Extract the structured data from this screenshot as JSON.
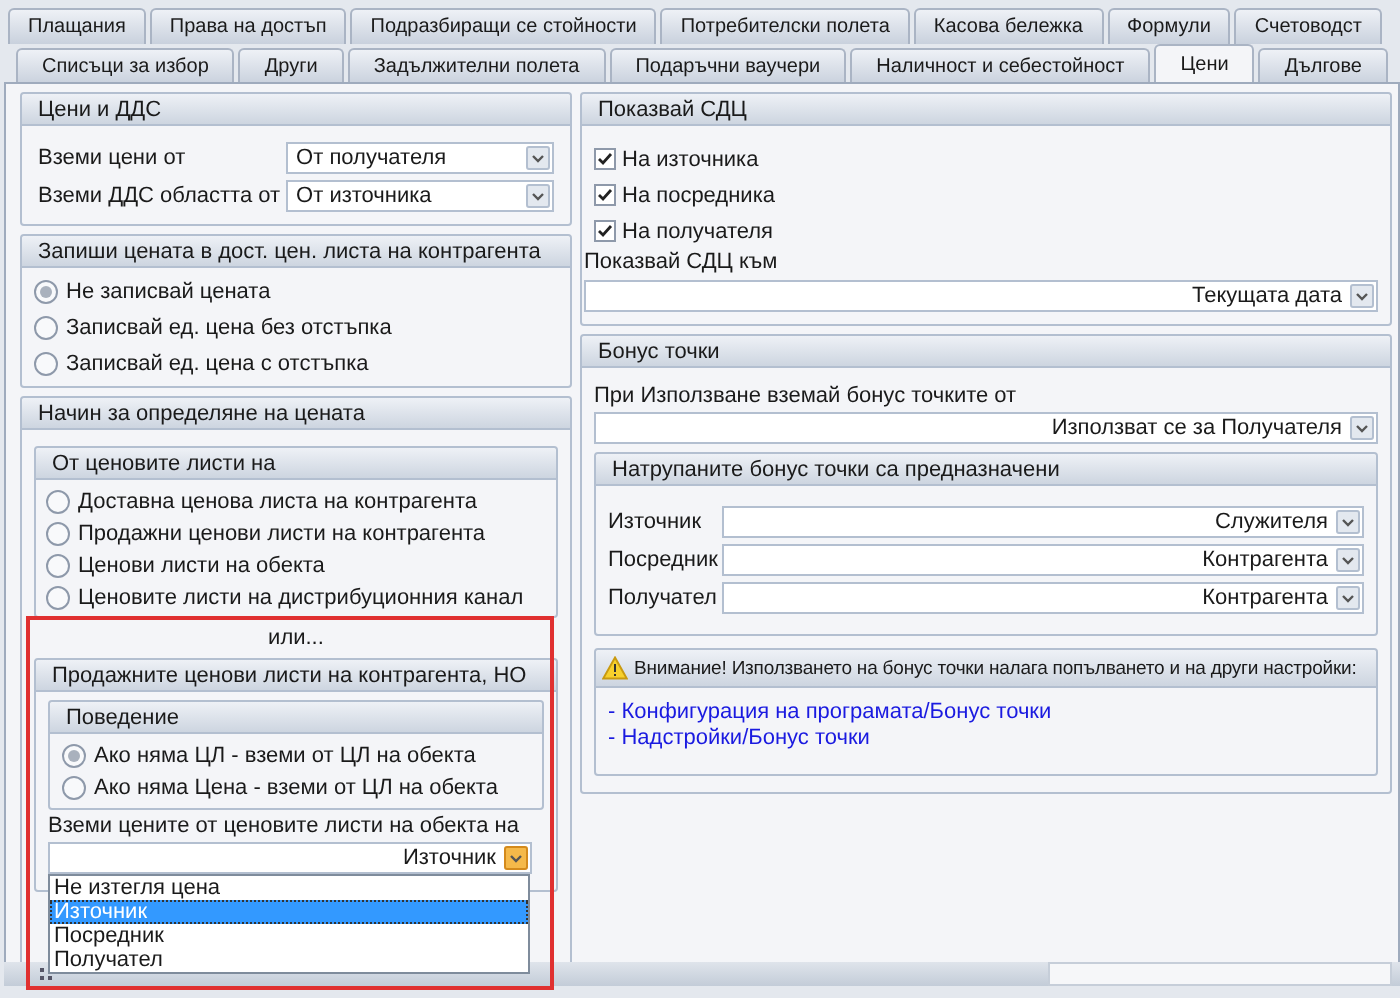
{
  "tabs": {
    "row_1": [
      {
        "label": "Плащания",
        "selected": false
      },
      {
        "label": "Права на достъп",
        "selected": false
      },
      {
        "label": "Подразбиращи се стойности",
        "selected": false
      },
      {
        "label": "Потребителски полета",
        "selected": false
      },
      {
        "label": "Касова бележка",
        "selected": false
      },
      {
        "label": "Формули",
        "selected": false
      },
      {
        "label": "Счетоводст",
        "selected": false
      }
    ],
    "row_2": [
      {
        "label": "Списъци за избор",
        "selected": false
      },
      {
        "label": "Други",
        "selected": false
      },
      {
        "label": "Задължителни полета",
        "selected": false
      },
      {
        "label": "Подаръчни ваучери",
        "selected": false
      },
      {
        "label": "Наличност и себестойност",
        "selected": false
      },
      {
        "label": "Цени",
        "selected": true
      },
      {
        "label": "Дългове",
        "selected": false
      }
    ]
  },
  "prices_vat": {
    "title": "Цени и ДДС",
    "fields": [
      {
        "label": "Вземи цени от",
        "value": "От получателя"
      },
      {
        "label": "Вземи ДДС областта от",
        "value": "От източника"
      }
    ]
  },
  "write_price": {
    "title": "Запиши цената в дост. цен. листа на контрагента",
    "options": [
      {
        "label": "Не записвай цената",
        "selected": true
      },
      {
        "label": "Записвай ед. цена без отстъпка",
        "selected": false
      },
      {
        "label": "Записвай ед. цена с отстъпка",
        "selected": false
      }
    ]
  },
  "price_method": {
    "title": "Начин за определяне на цената",
    "price_lists": {
      "title": "От ценовите листи на",
      "options": [
        {
          "label": "Доставна ценова листа на контрагента",
          "selected": false
        },
        {
          "label": "Продажни ценови листи на контрагента",
          "selected": false
        },
        {
          "label": "Ценови листи на обекта",
          "selected": false
        },
        {
          "label": "Ценовите листи на дистрибуционния канал",
          "selected": false
        }
      ]
    },
    "separator": "или...",
    "sales_lists": {
      "title": "Продажните ценови листи на контрагента, НО",
      "behavior": {
        "title": "Поведение",
        "options": [
          {
            "label": "Ако няма ЦЛ - вземи от ЦЛ на обекта",
            "selected": true
          },
          {
            "label": "Ако няма Цена - вземи от ЦЛ на обекта",
            "selected": false
          }
        ]
      },
      "source_label": "Вземи цените от ценовите листи на обекта на",
      "source_value": "Източник",
      "expanded": true,
      "dropdown": [
        {
          "label": "Не изтегля цена",
          "selected": false
        },
        {
          "label": "Източник",
          "selected": true
        },
        {
          "label": "Посредник",
          "selected": false
        },
        {
          "label": "Получател",
          "selected": false
        }
      ]
    }
  },
  "show_sdc": {
    "title": "Показвай СДЦ",
    "checks": [
      {
        "label": "На източника",
        "checked": true
      },
      {
        "label": "На посредника",
        "checked": true
      },
      {
        "label": "На получателя",
        "checked": true
      }
    ],
    "label": "Показвай СДЦ към",
    "value": "Текущата дата"
  },
  "bonus": {
    "title": "Бонус точки",
    "label": "При Използване вземай бонус точките от",
    "value": "Използват се за Получателя",
    "allocation": {
      "title": "Натрупаните бонус точки са предназначени",
      "rows": [
        {
          "label": "Източник",
          "value": "Служителя"
        },
        {
          "label": "Посредник",
          "value": "Контрагента"
        },
        {
          "label": "Получател",
          "value": "Контрагента"
        }
      ]
    },
    "warning": {
      "title": "Внимание! Използването на бонус точки налага попълването и на други настройки:",
      "links": [
        "- Конфигурация на програмата/Бонус точки",
        "- Надстройки/Бонус точки"
      ]
    }
  }
}
